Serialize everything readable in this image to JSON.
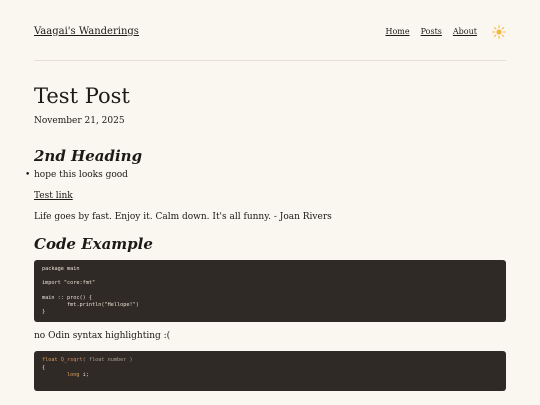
{
  "header": {
    "site_title": "Vaagai's Wanderings",
    "nav": [
      "Home",
      "Posts",
      "About"
    ],
    "theme_icon": "sun-icon",
    "accent": "#f5b93f"
  },
  "post": {
    "title": "Test Post",
    "date": "November 21, 2025",
    "heading2": "2nd Heading",
    "bullet": "hope this looks good",
    "link_text": "Test link",
    "quote": "Life goes by fast. Enjoy it. Calm down. It's all funny. - Joan Rivers",
    "code_heading": "Code Example",
    "code1": "package main\n\nimport \"core:fmt\"\n\nmain :: proc() {\n        fmt.println(\"Hellope!\")\n}",
    "no_highlight": "no Odin syntax highlighting :(",
    "code2_line1_kw": "float",
    "code2_line1_fn": "Q_rsqrt",
    "code2_line1_rest": "( float number )",
    "code2_line2": "{",
    "code2_line3_kw": "long",
    "code2_line3_rest": " i;"
  },
  "colors": {
    "background": "#faf6f0",
    "code_bg": "#2f2a25",
    "text": "#1c1a17"
  }
}
